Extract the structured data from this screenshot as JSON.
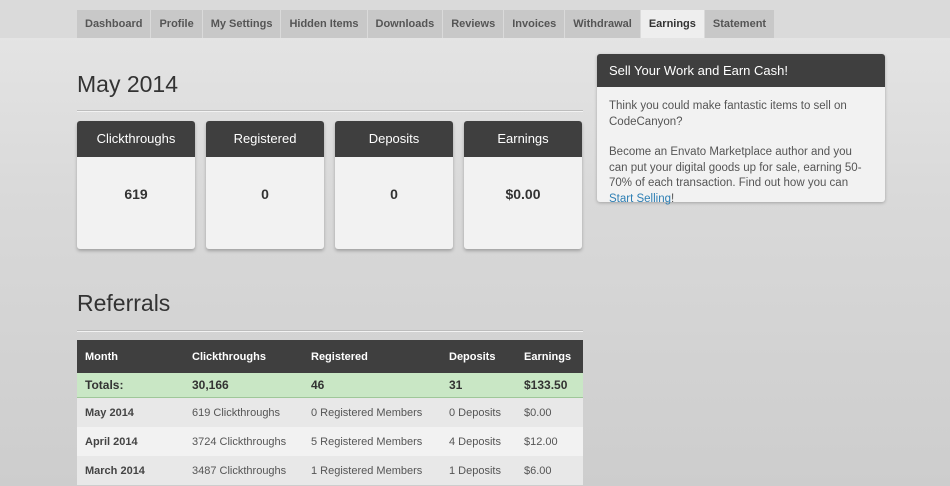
{
  "tabs": [
    "Dashboard",
    "Profile",
    "My Settings",
    "Hidden Items",
    "Downloads",
    "Reviews",
    "Invoices",
    "Withdrawal",
    "Earnings",
    "Statement"
  ],
  "active_tab": "Earnings",
  "month_title": "May 2014",
  "stats": [
    {
      "label": "Clickthroughs",
      "value": "619"
    },
    {
      "label": "Registered",
      "value": "0"
    },
    {
      "label": "Deposits",
      "value": "0"
    },
    {
      "label": "Earnings",
      "value": "$0.00"
    }
  ],
  "promo": {
    "title": "Sell Your Work and Earn Cash!",
    "para1": "Think you could make fantastic items to sell on CodeCanyon?",
    "para2": "Become an Envato Marketplace author and you can put your digital goods up for sale, earning 50-70% of each transaction. Find out how you can",
    "link": "Start Selling",
    "after_link": "!"
  },
  "referrals_title": "Referrals",
  "table": {
    "headers": [
      "Month",
      "Clickthroughs",
      "Registered",
      "Deposits",
      "Earnings"
    ],
    "totals": [
      "Totals:",
      "30,166",
      "46",
      "31",
      "$133.50"
    ],
    "rows": [
      [
        "May 2014",
        "619 Clickthroughs",
        "0 Registered Members",
        "0 Deposits",
        "$0.00"
      ],
      [
        "April 2014",
        "3724 Clickthroughs",
        "5 Registered Members",
        "4 Deposits",
        "$12.00"
      ],
      [
        "March 2014",
        "3487 Clickthroughs",
        "1 Registered Members",
        "1 Deposits",
        "$6.00"
      ]
    ]
  }
}
